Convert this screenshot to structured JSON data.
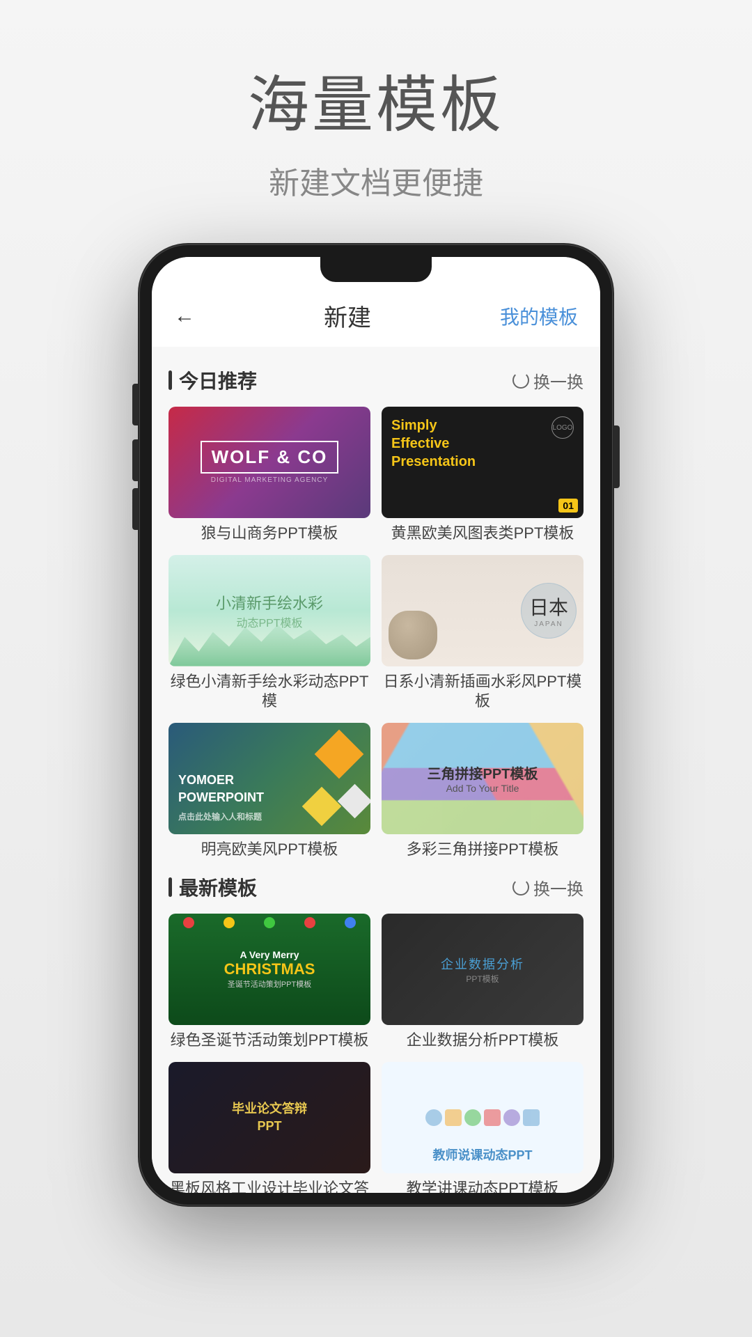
{
  "page": {
    "title": "海量模板",
    "subtitle": "新建文档更便捷"
  },
  "app_header": {
    "back_label": "←",
    "title": "新建",
    "action_label": "我的模板"
  },
  "sections": [
    {
      "id": "today",
      "title": "今日推荐",
      "action_label": "换一换",
      "templates": [
        {
          "id": "wolf",
          "title": "WOLF & CO",
          "label": "狼与山商务PPT模板"
        },
        {
          "id": "presentation",
          "title": "Simply Effective Presentation",
          "logo": "LOGO",
          "num": "01",
          "label": "黄黑欧美风图表类PPT模板"
        },
        {
          "id": "watercolor",
          "title": "小清新手绘水彩",
          "subtitle": "动态PPT模板",
          "label": "绿色小清新手绘水彩动态PPT模"
        },
        {
          "id": "japan",
          "kanji": "日本",
          "text": "JAPAN",
          "label": "日系小清新插画水彩风PPT模板"
        },
        {
          "id": "yomoer",
          "brand": "YOMOER",
          "brand2": "POWERPOINT",
          "sub": "点击此处输入人和标题",
          "label": "明亮欧美风PPT模板"
        },
        {
          "id": "triangles",
          "title": "三角拼接PPT模板",
          "subtitle": "Add To Your Title",
          "label": "多彩三角拼接PPT模板"
        }
      ]
    },
    {
      "id": "latest",
      "title": "最新模板",
      "action_label": "换一换",
      "templates": [
        {
          "id": "christmas",
          "title": "A Very Merry CHRISTMAS",
          "subtitle": "圣诞节活动策划PPT模板",
          "label": "绿色圣诞节活动策划PPT模板"
        },
        {
          "id": "business_data",
          "title": "企业数据分析",
          "label": "企业数据分析PPT模板"
        },
        {
          "id": "graduation",
          "title": "毕业论文答辩PPT",
          "label": "黑板风格工业设计毕业论文答"
        },
        {
          "id": "teacher",
          "title": "教师说课动态PPT",
          "label": "教学讲课动态PPT模板"
        }
      ]
    }
  ]
}
